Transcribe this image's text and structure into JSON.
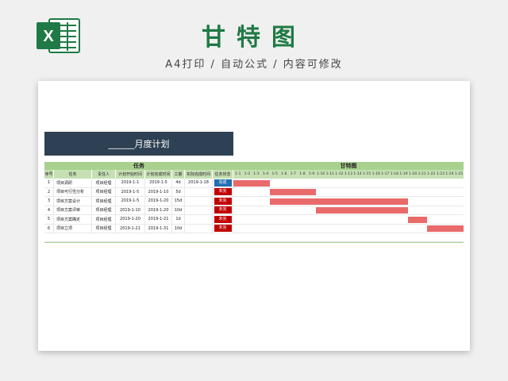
{
  "header": {
    "title": "甘特图",
    "subtitle": "A4打印 / 自动公式 / 内容可修改",
    "logo_letter": "X"
  },
  "sheet": {
    "banner": "______月度计划",
    "task_group_header": "任务",
    "gantt_group_header": "甘特图",
    "columns": [
      "序号",
      "任务",
      "责任人",
      "计划开始时间",
      "计划完成时间",
      "工期",
      "实际完成时间",
      "任务状态"
    ],
    "dates": [
      "1-1",
      "1-2",
      "1-3",
      "1-4",
      "1-5",
      "1-6",
      "1-7",
      "1-8",
      "1-9",
      "1-10",
      "1-11",
      "1-12",
      "1-13",
      "1-14",
      "1-15",
      "1-16",
      "1-17",
      "1-18",
      "1-19",
      "1-20",
      "1-21",
      "1-22",
      "1-23",
      "1-24",
      "1-25"
    ],
    "rows": [
      {
        "no": "1",
        "name": "项目调研",
        "owner": "项目经理",
        "start": "2019-1-1",
        "plan": "2019-1-5",
        "days": "4d",
        "actual": "2019-1-18",
        "status": "完成",
        "status_color": "#1f6fb2",
        "bar_start_day": 1,
        "bar_end_day": 5
      },
      {
        "no": "2",
        "name": "项目可行性分析",
        "owner": "项目经理",
        "start": "2019-1-5",
        "plan": "2019-1-10",
        "days": "5d",
        "actual": "",
        "status": "未完",
        "status_color": "#c00000",
        "bar_start_day": 5,
        "bar_end_day": 10
      },
      {
        "no": "3",
        "name": "项目方案设计",
        "owner": "项目经理",
        "start": "2019-1-5",
        "plan": "2019-1-20",
        "days": "15d",
        "actual": "",
        "status": "未完",
        "status_color": "#c00000",
        "bar_start_day": 5,
        "bar_end_day": 20
      },
      {
        "no": "4",
        "name": "项目方案评审",
        "owner": "项目经理",
        "start": "2019-1-10",
        "plan": "2019-1-20",
        "days": "10d",
        "actual": "",
        "status": "未完",
        "status_color": "#c00000",
        "bar_start_day": 10,
        "bar_end_day": 20
      },
      {
        "no": "5",
        "name": "项目方案确定",
        "owner": "项目经理",
        "start": "2019-1-20",
        "plan": "2019-1-21",
        "days": "1d",
        "actual": "",
        "status": "未完",
        "status_color": "#c00000",
        "bar_start_day": 20,
        "bar_end_day": 22
      },
      {
        "no": "6",
        "name": "项目立项",
        "owner": "项目经理",
        "start": "2019-1-21",
        "plan": "2019-1-31",
        "days": "10d",
        "actual": "",
        "status": "未完",
        "status_color": "#c00000",
        "bar_start_day": 22,
        "bar_end_day": 26
      }
    ]
  },
  "colors": {
    "bar": "#e96a6a",
    "header_green": "#a9d18e",
    "banner": "#2e4053",
    "title_green": "#1f7a45"
  }
}
